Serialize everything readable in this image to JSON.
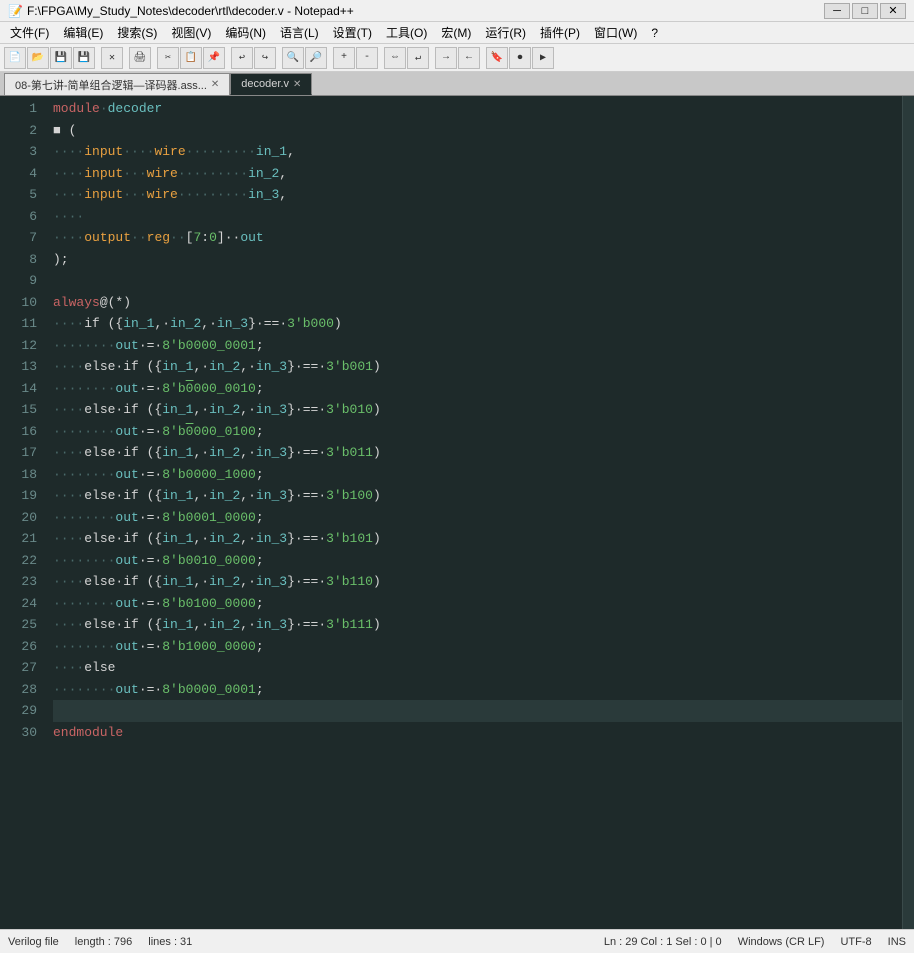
{
  "titlebar": {
    "title": "F:\\FPGA\\My_Study_Notes\\decoder\\rtl\\decoder.v - Notepad++",
    "min_label": "─",
    "max_label": "□",
    "close_label": "✕"
  },
  "menubar": {
    "items": [
      "文件(F)",
      "编辑(E)",
      "搜索(S)",
      "视图(V)",
      "编码(N)",
      "语言(L)",
      "设置(T)",
      "工具(O)",
      "宏(M)",
      "运行(R)",
      "插件(P)",
      "窗口(W)",
      "?"
    ]
  },
  "tabs": [
    {
      "label": "08-第七讲-简单组合逻辑—译码器.ass...",
      "active": false,
      "closable": true
    },
    {
      "label": "decoder.v",
      "active": true,
      "closable": true
    }
  ],
  "statusbar": {
    "filetype": "Verilog file",
    "length": "length : 796",
    "lines": "lines : 31",
    "position": "Ln : 29    Col : 1    Sel : 0 | 0",
    "line_ending": "Windows (CR LF)",
    "encoding": "UTF-8",
    "ins": "INS"
  },
  "lines": [
    {
      "num": 1
    },
    {
      "num": 2
    },
    {
      "num": 3
    },
    {
      "num": 4
    },
    {
      "num": 5
    },
    {
      "num": 6
    },
    {
      "num": 7
    },
    {
      "num": 8
    },
    {
      "num": 9
    },
    {
      "num": 10
    },
    {
      "num": 11
    },
    {
      "num": 12
    },
    {
      "num": 13
    },
    {
      "num": 14
    },
    {
      "num": 15
    },
    {
      "num": 16
    },
    {
      "num": 17
    },
    {
      "num": 18
    },
    {
      "num": 19
    },
    {
      "num": 20
    },
    {
      "num": 21
    },
    {
      "num": 22
    },
    {
      "num": 23
    },
    {
      "num": 24
    },
    {
      "num": 25
    },
    {
      "num": 26
    },
    {
      "num": 27
    },
    {
      "num": 28
    },
    {
      "num": 29
    },
    {
      "num": 30
    }
  ]
}
